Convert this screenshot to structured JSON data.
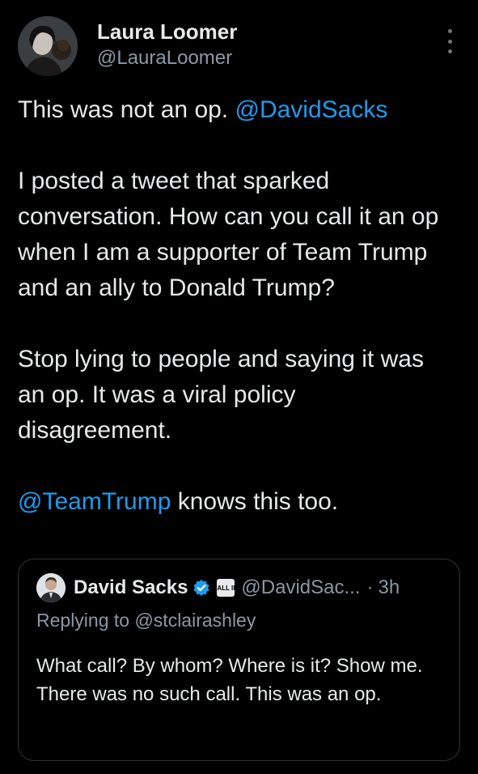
{
  "author": {
    "display_name": "Laura Loomer",
    "handle": "@LauraLoomer"
  },
  "tweet": {
    "line1_text": "This was not an op. ",
    "line1_mention": "@DavidSacks",
    "para2": "I posted a tweet that sparked conversation. How can you call it an op when I am a supporter of Team Trump and an ally to Donald Trump?",
    "para3": "Stop lying to people and saying it was an op. It was a viral policy disagreement.",
    "para4_mention": "@TeamTrump",
    "para4_text": " knows this too."
  },
  "quoted": {
    "display_name": "David Sacks",
    "badge_text": "ALL IN",
    "handle": "@DavidSac...",
    "separator": "·",
    "time": "3h",
    "replying_to": "Replying to @stclairashley",
    "text": "What call? By whom? Where is it? Show me. There was no such call. This was an op."
  },
  "colors": {
    "background": "#000000",
    "text": "#e7e9ea",
    "secondary": "#8b98a5",
    "link": "#1d9bf0",
    "border": "#2f3336"
  },
  "icons": [
    "avatar",
    "more-icon",
    "verified-badge-icon",
    "all-in-badge-icon"
  ]
}
